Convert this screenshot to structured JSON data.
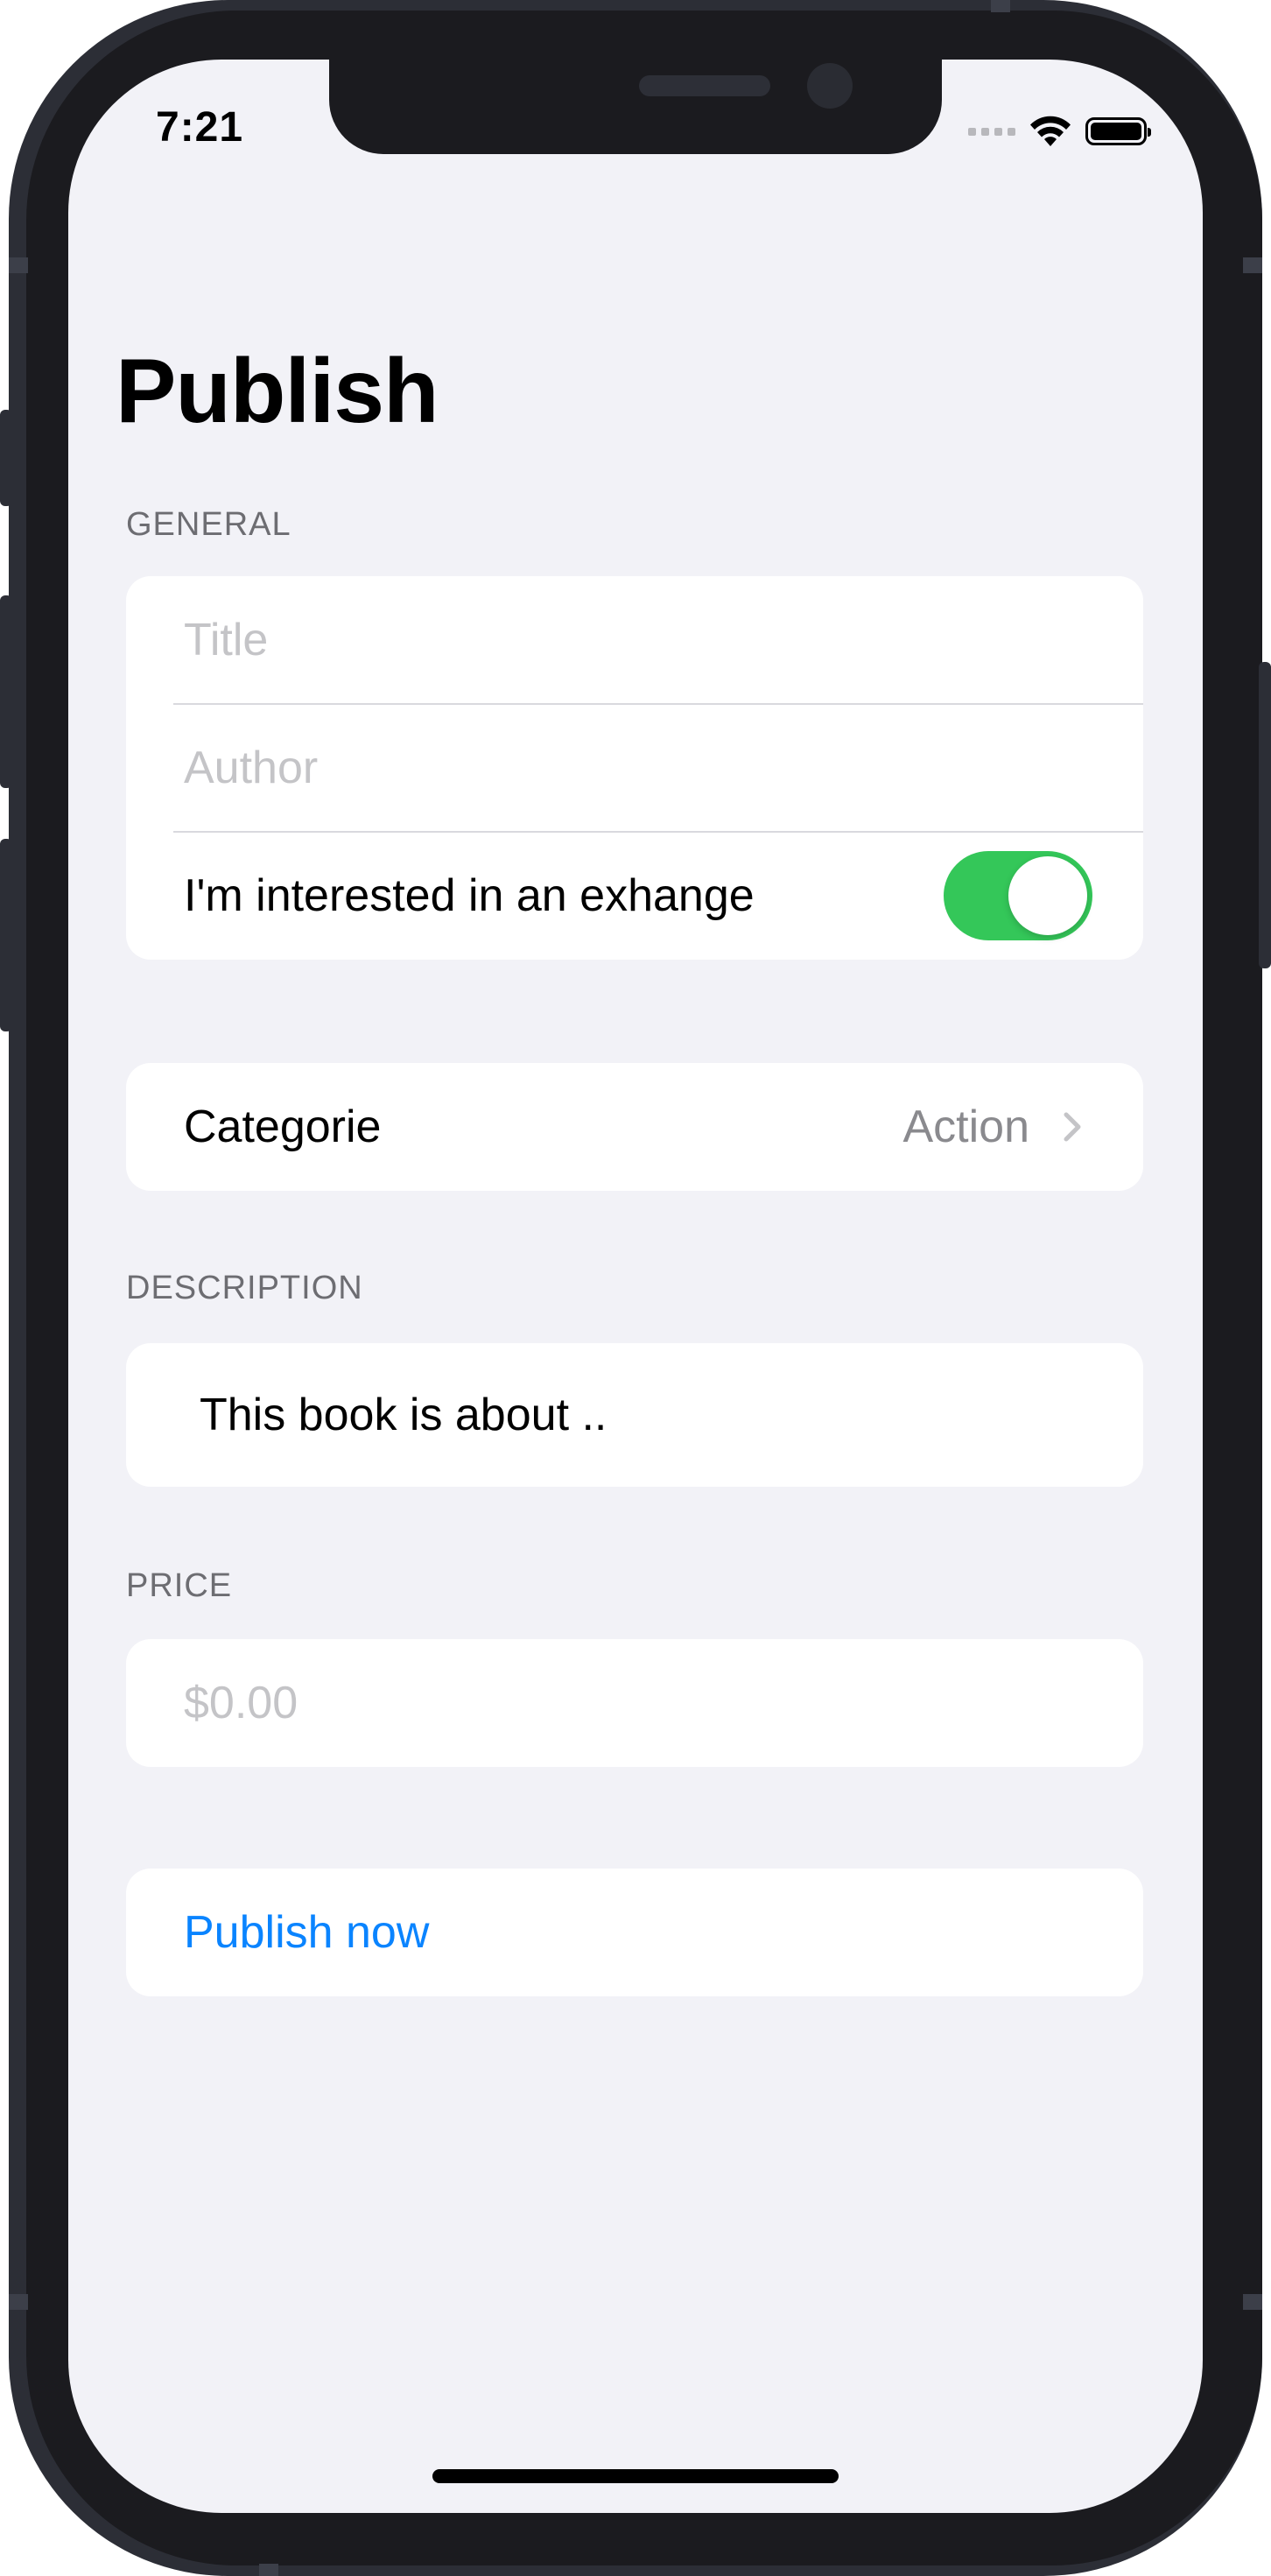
{
  "status_bar": {
    "time": "7:21"
  },
  "page": {
    "title": "Publish"
  },
  "general": {
    "header": "GENERAL",
    "title_placeholder": "Title",
    "author_placeholder": "Author",
    "exchange_label": "I'm interested in an exhange",
    "exchange_toggle": "on"
  },
  "category": {
    "label": "Categorie",
    "value": "Action"
  },
  "description": {
    "header": "DESCRIPTION",
    "text": "This book is about .."
  },
  "price": {
    "header": "PRICE",
    "placeholder": "$0.00"
  },
  "actions": {
    "publish_label": "Publish now"
  },
  "colors": {
    "background": "#f2f2f7",
    "toggle_on": "#34c759",
    "accent": "#0a84ff",
    "secondary_text": "#8a8a8e"
  },
  "icons": [
    "wifi-icon",
    "battery-icon",
    "chevron-right-icon"
  ]
}
